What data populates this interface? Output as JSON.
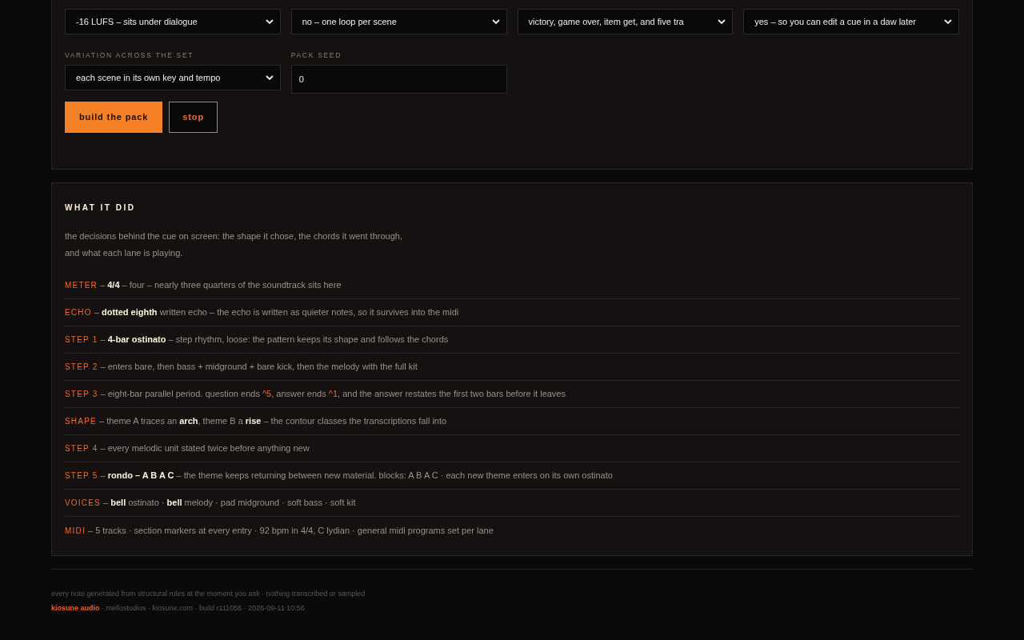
{
  "settings": {
    "selects": [
      {
        "value": "-16 LUFS – sits under dialogue"
      },
      {
        "value": "no – one loop per scene"
      },
      {
        "value": "victory, game over, item get, and five tra"
      },
      {
        "value": "yes – so you can edit a cue in a daw later"
      }
    ],
    "variation": {
      "label": "VARIATION ACROSS THE SET",
      "value": "each scene in its own key and tempo"
    },
    "seed": {
      "label": "PACK SEED",
      "value": "0"
    },
    "buttons": [
      {
        "label": "build the pack",
        "kind": "primary"
      },
      {
        "label": "stop",
        "kind": "outline"
      }
    ]
  },
  "report": {
    "title": "WHAT IT DID",
    "intro": [
      "the decisions behind the cue on screen: the shape it chose, the chords it went through,",
      "and what each lane is playing."
    ],
    "rows": [
      {
        "label": "METER",
        "parts": [
          {
            "kind": "plain",
            "text": " – "
          },
          {
            "kind": "bold",
            "text": "4/4"
          },
          {
            "kind": "plain",
            "text": " – four – nearly three quarters of the soundtrack sits here"
          }
        ]
      },
      {
        "label": "ECHO",
        "parts": [
          {
            "kind": "plain",
            "text": " – "
          },
          {
            "kind": "bold",
            "text": "dotted eighth"
          },
          {
            "kind": "plain",
            "text": " written echo – the echo is written as quieter notes, so it survives into the midi"
          }
        ]
      },
      {
        "label": "STEP 1",
        "parts": [
          {
            "kind": "plain",
            "text": " – "
          },
          {
            "kind": "bold",
            "text": "4-bar ostinato"
          },
          {
            "kind": "plain",
            "text": " – step rhythm, loose: the pattern keeps its shape and follows the chords"
          }
        ]
      },
      {
        "label": "STEP 2",
        "parts": [
          {
            "kind": "plain",
            "text": " – enters bare, then bass + midground + bare kick, then the melody with the full kit"
          }
        ]
      },
      {
        "label": "STEP 3",
        "parts": [
          {
            "kind": "plain",
            "text": " – eight-bar parallel period. question ends "
          },
          {
            "kind": "accent",
            "text": "^5"
          },
          {
            "kind": "plain",
            "text": ", answer ends "
          },
          {
            "kind": "accent",
            "text": "^1"
          },
          {
            "kind": "plain",
            "text": ", and the answer restates the first two bars before it leaves"
          }
        ]
      },
      {
        "label": "SHAPE",
        "parts": [
          {
            "kind": "plain",
            "text": " – theme A traces an "
          },
          {
            "kind": "bold",
            "text": "arch"
          },
          {
            "kind": "plain",
            "text": ", theme B a "
          },
          {
            "kind": "bold",
            "text": "rise"
          },
          {
            "kind": "plain",
            "text": " – the contour classes the transcriptions fall into"
          }
        ]
      },
      {
        "label": "STEP 4",
        "parts": [
          {
            "kind": "plain",
            "text": " – every melodic unit stated twice before anything new"
          }
        ]
      },
      {
        "label": "STEP 5",
        "parts": [
          {
            "kind": "plain",
            "text": " – "
          },
          {
            "kind": "bold",
            "text": "rondo – A B A C"
          },
          {
            "kind": "plain",
            "text": " – the theme keeps returning between new material. blocks: A B A C · each new theme enters on its own ostinato"
          }
        ]
      },
      {
        "label": "VOICES",
        "parts": [
          {
            "kind": "plain",
            "text": " – "
          },
          {
            "kind": "bold",
            "text": "bell"
          },
          {
            "kind": "plain",
            "text": " ostinato · "
          },
          {
            "kind": "bold",
            "text": "bell"
          },
          {
            "kind": "plain",
            "text": " melody · pad midground · soft bass · soft kit"
          }
        ]
      },
      {
        "label": "MIDI",
        "parts": [
          {
            "kind": "plain",
            "text": " – 5 tracks · section markers at every entry · 92 bpm in 4/4, C lydian · general midi programs set per lane"
          }
        ]
      }
    ]
  },
  "footer": {
    "note": "every note generated from structural rules at the moment you ask · nothing transcribed or sampled",
    "brand": "kiosune audio",
    "meta": " · mellostudios · kiosune.com · build r111056 · 2026-09-11 10:56"
  }
}
